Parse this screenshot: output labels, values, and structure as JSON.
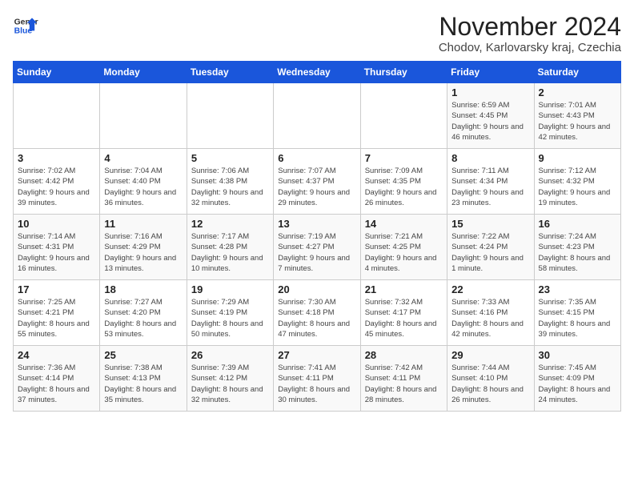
{
  "logo": {
    "line1": "General",
    "line2": "Blue"
  },
  "header": {
    "month": "November 2024",
    "location": "Chodov, Karlovarsky kraj, Czechia"
  },
  "weekdays": [
    "Sunday",
    "Monday",
    "Tuesday",
    "Wednesday",
    "Thursday",
    "Friday",
    "Saturday"
  ],
  "weeks": [
    [
      {
        "day": "",
        "info": ""
      },
      {
        "day": "",
        "info": ""
      },
      {
        "day": "",
        "info": ""
      },
      {
        "day": "",
        "info": ""
      },
      {
        "day": "",
        "info": ""
      },
      {
        "day": "1",
        "info": "Sunrise: 6:59 AM\nSunset: 4:45 PM\nDaylight: 9 hours and 46 minutes."
      },
      {
        "day": "2",
        "info": "Sunrise: 7:01 AM\nSunset: 4:43 PM\nDaylight: 9 hours and 42 minutes."
      }
    ],
    [
      {
        "day": "3",
        "info": "Sunrise: 7:02 AM\nSunset: 4:42 PM\nDaylight: 9 hours and 39 minutes."
      },
      {
        "day": "4",
        "info": "Sunrise: 7:04 AM\nSunset: 4:40 PM\nDaylight: 9 hours and 36 minutes."
      },
      {
        "day": "5",
        "info": "Sunrise: 7:06 AM\nSunset: 4:38 PM\nDaylight: 9 hours and 32 minutes."
      },
      {
        "day": "6",
        "info": "Sunrise: 7:07 AM\nSunset: 4:37 PM\nDaylight: 9 hours and 29 minutes."
      },
      {
        "day": "7",
        "info": "Sunrise: 7:09 AM\nSunset: 4:35 PM\nDaylight: 9 hours and 26 minutes."
      },
      {
        "day": "8",
        "info": "Sunrise: 7:11 AM\nSunset: 4:34 PM\nDaylight: 9 hours and 23 minutes."
      },
      {
        "day": "9",
        "info": "Sunrise: 7:12 AM\nSunset: 4:32 PM\nDaylight: 9 hours and 19 minutes."
      }
    ],
    [
      {
        "day": "10",
        "info": "Sunrise: 7:14 AM\nSunset: 4:31 PM\nDaylight: 9 hours and 16 minutes."
      },
      {
        "day": "11",
        "info": "Sunrise: 7:16 AM\nSunset: 4:29 PM\nDaylight: 9 hours and 13 minutes."
      },
      {
        "day": "12",
        "info": "Sunrise: 7:17 AM\nSunset: 4:28 PM\nDaylight: 9 hours and 10 minutes."
      },
      {
        "day": "13",
        "info": "Sunrise: 7:19 AM\nSunset: 4:27 PM\nDaylight: 9 hours and 7 minutes."
      },
      {
        "day": "14",
        "info": "Sunrise: 7:21 AM\nSunset: 4:25 PM\nDaylight: 9 hours and 4 minutes."
      },
      {
        "day": "15",
        "info": "Sunrise: 7:22 AM\nSunset: 4:24 PM\nDaylight: 9 hours and 1 minute."
      },
      {
        "day": "16",
        "info": "Sunrise: 7:24 AM\nSunset: 4:23 PM\nDaylight: 8 hours and 58 minutes."
      }
    ],
    [
      {
        "day": "17",
        "info": "Sunrise: 7:25 AM\nSunset: 4:21 PM\nDaylight: 8 hours and 55 minutes."
      },
      {
        "day": "18",
        "info": "Sunrise: 7:27 AM\nSunset: 4:20 PM\nDaylight: 8 hours and 53 minutes."
      },
      {
        "day": "19",
        "info": "Sunrise: 7:29 AM\nSunset: 4:19 PM\nDaylight: 8 hours and 50 minutes."
      },
      {
        "day": "20",
        "info": "Sunrise: 7:30 AM\nSunset: 4:18 PM\nDaylight: 8 hours and 47 minutes."
      },
      {
        "day": "21",
        "info": "Sunrise: 7:32 AM\nSunset: 4:17 PM\nDaylight: 8 hours and 45 minutes."
      },
      {
        "day": "22",
        "info": "Sunrise: 7:33 AM\nSunset: 4:16 PM\nDaylight: 8 hours and 42 minutes."
      },
      {
        "day": "23",
        "info": "Sunrise: 7:35 AM\nSunset: 4:15 PM\nDaylight: 8 hours and 39 minutes."
      }
    ],
    [
      {
        "day": "24",
        "info": "Sunrise: 7:36 AM\nSunset: 4:14 PM\nDaylight: 8 hours and 37 minutes."
      },
      {
        "day": "25",
        "info": "Sunrise: 7:38 AM\nSunset: 4:13 PM\nDaylight: 8 hours and 35 minutes."
      },
      {
        "day": "26",
        "info": "Sunrise: 7:39 AM\nSunset: 4:12 PM\nDaylight: 8 hours and 32 minutes."
      },
      {
        "day": "27",
        "info": "Sunrise: 7:41 AM\nSunset: 4:11 PM\nDaylight: 8 hours and 30 minutes."
      },
      {
        "day": "28",
        "info": "Sunrise: 7:42 AM\nSunset: 4:11 PM\nDaylight: 8 hours and 28 minutes."
      },
      {
        "day": "29",
        "info": "Sunrise: 7:44 AM\nSunset: 4:10 PM\nDaylight: 8 hours and 26 minutes."
      },
      {
        "day": "30",
        "info": "Sunrise: 7:45 AM\nSunset: 4:09 PM\nDaylight: 8 hours and 24 minutes."
      }
    ]
  ]
}
